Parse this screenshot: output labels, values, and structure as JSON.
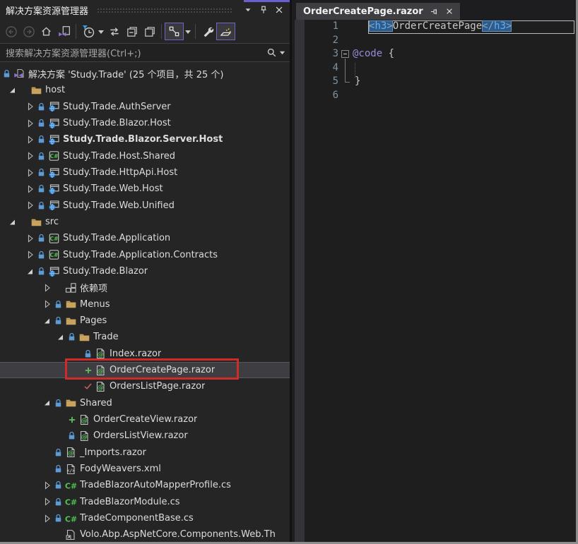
{
  "panel": {
    "title": "解决方案资源管理器",
    "search_placeholder": "搜索解决方案资源管理器(Ctrl+;)",
    "titlebar_icons": [
      "window-position-icon",
      "pin-icon",
      "close-icon"
    ],
    "toolbar": {
      "buttons": [
        {
          "name": "nav-back",
          "disabled": true
        },
        {
          "name": "nav-forward",
          "disabled": true
        },
        {
          "name": "home"
        },
        {
          "name": "switch-views"
        },
        {
          "sep": true
        },
        {
          "name": "pending-changes-filter",
          "dropdown": true
        },
        {
          "name": "sync-with-active-document"
        },
        {
          "name": "collapse-all"
        },
        {
          "name": "show-all-files"
        },
        {
          "sep": true
        },
        {
          "name": "track-active-item",
          "boxed": true,
          "dropdown": true
        },
        {
          "sep": true
        },
        {
          "name": "properties"
        },
        {
          "name": "preview-selected-items",
          "boxed": true
        }
      ]
    }
  },
  "tree": {
    "rows": [
      {
        "level": 0,
        "noexp": true,
        "status": "lock",
        "icon": "solution",
        "label": "解决方案 'Study.Trade' (25 个项目，共 25 个)"
      },
      {
        "level": 1,
        "exp": "open",
        "status": "",
        "icon": "folder",
        "label": "host"
      },
      {
        "level": 2,
        "exp": "closed",
        "status": "lock",
        "icon": "web",
        "label": "Study.Trade.AuthServer"
      },
      {
        "level": 2,
        "exp": "closed",
        "status": "lock",
        "icon": "web",
        "label": "Study.Trade.Blazor.Host"
      },
      {
        "level": 2,
        "exp": "closed",
        "status": "lock",
        "icon": "web",
        "label": "Study.Trade.Blazor.Server.Host",
        "bold": true
      },
      {
        "level": 2,
        "exp": "closed",
        "status": "lock",
        "icon": "csproj",
        "label": "Study.Trade.Host.Shared"
      },
      {
        "level": 2,
        "exp": "closed",
        "status": "lock",
        "icon": "web",
        "label": "Study.Trade.HttpApi.Host"
      },
      {
        "level": 2,
        "exp": "closed",
        "status": "lock",
        "icon": "web",
        "label": "Study.Trade.Web.Host"
      },
      {
        "level": 2,
        "exp": "closed",
        "status": "lock",
        "icon": "web",
        "label": "Study.Trade.Web.Unified"
      },
      {
        "level": 1,
        "exp": "open",
        "status": "",
        "icon": "folder",
        "label": "src"
      },
      {
        "level": 2,
        "exp": "closed",
        "status": "lock",
        "icon": "csproj",
        "label": "Study.Trade.Application"
      },
      {
        "level": 2,
        "exp": "closed",
        "status": "lock",
        "icon": "csproj",
        "label": "Study.Trade.Application.Contracts"
      },
      {
        "level": 2,
        "exp": "open",
        "status": "lock",
        "icon": "web",
        "label": "Study.Trade.Blazor"
      },
      {
        "level": 3,
        "exp": "closed",
        "status": "",
        "icon": "deps",
        "label": "依赖项"
      },
      {
        "level": 3,
        "exp": "closed",
        "status": "lock",
        "icon": "folder",
        "label": "Menus"
      },
      {
        "level": 3,
        "exp": "open",
        "status": "lock",
        "icon": "folder",
        "label": "Pages"
      },
      {
        "level": 4,
        "exp": "open",
        "status": "lock",
        "icon": "folder",
        "label": "Trade"
      },
      {
        "level": 5,
        "noexpslot": false,
        "status": "lock",
        "icon": "razor",
        "label": "Index.razor"
      },
      {
        "level": 5,
        "status": "plus",
        "icon": "razor",
        "label": "OrderCreatePage.razor",
        "selected": true,
        "annotated": true
      },
      {
        "level": 5,
        "status": "check",
        "icon": "razor",
        "label": "OrdersListPage.razor"
      },
      {
        "level": 3,
        "exp": "open",
        "status": "lock",
        "icon": "folder",
        "label": "Shared"
      },
      {
        "level": 4,
        "status": "plus",
        "icon": "razor",
        "label": "OrderCreateView.razor"
      },
      {
        "level": 4,
        "status": "lock",
        "icon": "razor",
        "label": "OrdersListView.razor"
      },
      {
        "level": 3,
        "status": "lock",
        "icon": "razor",
        "label": "_Imports.razor"
      },
      {
        "level": 3,
        "status": "lock",
        "icon": "xml",
        "label": "FodyWeavers.xml"
      },
      {
        "level": 3,
        "exp": "closed",
        "status": "lock",
        "icon": "cs",
        "label": "TradeBlazorAutoMapperProfile.cs"
      },
      {
        "level": 3,
        "exp": "closed",
        "status": "lock",
        "icon": "cs",
        "label": "TradeBlazorModule.cs"
      },
      {
        "level": 3,
        "exp": "closed",
        "status": "lock",
        "icon": "cs",
        "label": "TradeComponentBase.cs"
      },
      {
        "level": 3,
        "status": "",
        "icon": "linked",
        "label": "Volo.Abp.AspNetCore.Components.Web.Th"
      }
    ]
  },
  "editor": {
    "tab_title": "OrderCreatePage.razor",
    "tab_icons": [
      "pin-icon",
      "close-icon"
    ],
    "lines": [
      {
        "num": "1",
        "indent": 23,
        "outlined": true,
        "tokens": [
          {
            "c": "tagbox",
            "parts": [
              [
                "delim",
                "<"
              ],
              [
                "tag",
                "h3"
              ],
              [
                "delim",
                ">"
              ]
            ]
          },
          {
            "c": "plain",
            "text": "OrderCreatePage"
          },
          {
            "c": "tagbox",
            "parts": [
              [
                "delim",
                "</"
              ],
              [
                "tag",
                "h3"
              ],
              [
                "delim",
                ">"
              ]
            ]
          }
        ]
      },
      {
        "num": "2",
        "tokens": []
      },
      {
        "num": "3",
        "fold": true,
        "tokens": [
          {
            "c": "directive",
            "text": "@code"
          },
          {
            "c": "plain",
            "text": " {"
          }
        ]
      },
      {
        "num": "4",
        "tokens": []
      },
      {
        "num": "5",
        "indent": 3,
        "tokens": [
          {
            "c": "plain",
            "text": "}"
          }
        ]
      },
      {
        "num": "6",
        "tokens": []
      }
    ]
  },
  "colors": {
    "panel_bg": "#252526",
    "editor_bg": "#1E1E1E",
    "accent_purple": "#6A5FD1",
    "annotation_red": "#CE2B2B",
    "folder": "#C8A35E",
    "lock_blue": "#5C9BD6",
    "pending_add_green": "#5FBF5F",
    "checked_red": "#C75B5B",
    "tag_highlight": "#2C5B8C",
    "directive_purple": "#9B89D8",
    "line_number": "#7E919F"
  }
}
